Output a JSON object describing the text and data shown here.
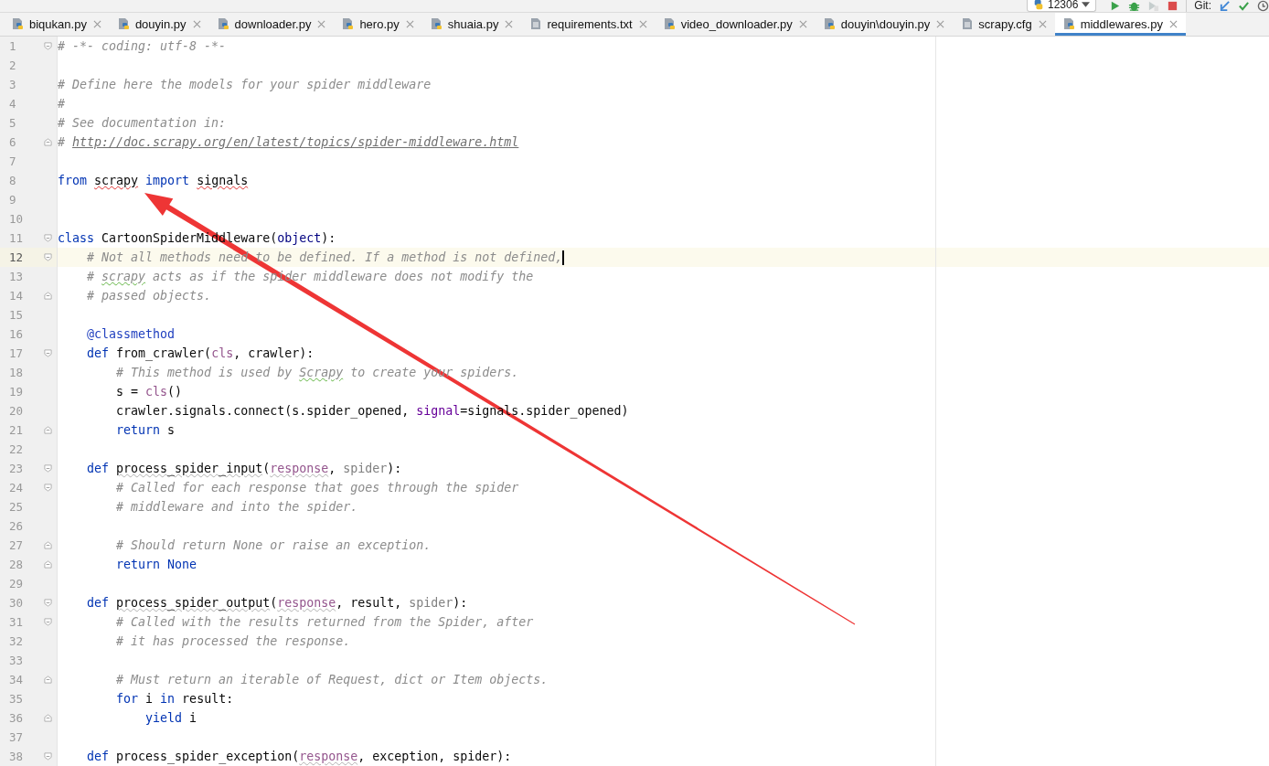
{
  "toolbar": {
    "run_config": "12306",
    "git_label": "Git:",
    "buttons": [
      {
        "kind": "run",
        "disabled": false
      },
      {
        "kind": "debug",
        "disabled": false
      },
      {
        "kind": "coverage",
        "disabled": true
      },
      {
        "kind": "stop",
        "disabled": false
      }
    ],
    "git_buttons": [
      {
        "kind": "update"
      },
      {
        "kind": "commit"
      },
      {
        "kind": "history"
      }
    ]
  },
  "tabs": [
    {
      "label": "biqukan.py",
      "kind": "python",
      "selected": false
    },
    {
      "label": "douyin.py",
      "kind": "python",
      "selected": false
    },
    {
      "label": "downloader.py",
      "kind": "python",
      "selected": false
    },
    {
      "label": "hero.py",
      "kind": "python",
      "selected": false
    },
    {
      "label": "shuaia.py",
      "kind": "python",
      "selected": false
    },
    {
      "label": "requirements.txt",
      "kind": "text",
      "selected": false
    },
    {
      "label": "video_downloader.py",
      "kind": "python",
      "selected": false
    },
    {
      "label": "douyin\\douyin.py",
      "kind": "python",
      "selected": false
    },
    {
      "label": "scrapy.cfg",
      "kind": "text",
      "selected": false
    },
    {
      "label": "middlewares.py",
      "kind": "python",
      "selected": true
    }
  ],
  "lines": [
    {
      "number": "1",
      "fold_open": true,
      "fold_close": false,
      "current": false,
      "tokens": [
        {
          "kind": "comment",
          "text": "# -*- coding: utf-8 -*-"
        }
      ]
    },
    {
      "number": "2",
      "fold_open": false,
      "fold_close": false,
      "current": false
    },
    {
      "number": "3",
      "fold_open": false,
      "fold_close": false,
      "current": false,
      "tokens": [
        {
          "kind": "comment",
          "text": "# Define here the models for your spider middleware"
        }
      ]
    },
    {
      "number": "4",
      "fold_open": false,
      "fold_close": false,
      "current": false,
      "tokens": [
        {
          "kind": "comment",
          "text": "#"
        }
      ]
    },
    {
      "number": "5",
      "fold_open": false,
      "fold_close": false,
      "current": false,
      "tokens": [
        {
          "kind": "comment",
          "text": "# See documentation in:"
        }
      ]
    },
    {
      "number": "6",
      "fold_open": false,
      "fold_close": true,
      "current": false,
      "tokens": [
        {
          "kind": "comment",
          "text": "# "
        },
        {
          "kind": "link",
          "text": "http://doc.scrapy.org/en/latest/topics/spider-middleware.html"
        }
      ]
    },
    {
      "number": "7",
      "fold_open": false,
      "fold_close": false,
      "current": false
    },
    {
      "number": "8",
      "fold_open": false,
      "fold_close": false,
      "current": false,
      "tokens": [
        {
          "kind": "keyword",
          "text": "from "
        },
        {
          "kind": "unresolved",
          "text": "scrapy"
        },
        {
          "kind": "keyword",
          "text": " import "
        },
        {
          "kind": "unresolved",
          "text": "signals"
        }
      ]
    },
    {
      "number": "9",
      "fold_open": false,
      "fold_close": false,
      "current": false
    },
    {
      "number": "10",
      "fold_open": false,
      "fold_close": false,
      "current": false
    },
    {
      "number": "11",
      "fold_open": true,
      "fold_close": false,
      "current": false,
      "tokens": [
        {
          "kind": "keyword",
          "text": "class"
        },
        {
          "kind": "plain",
          "text": " CartoonSpiderMiddleware("
        },
        {
          "kind": "builtin",
          "text": "object"
        },
        {
          "kind": "plain",
          "text": "):"
        }
      ]
    },
    {
      "number": "12",
      "fold_open": true,
      "fold_close": false,
      "current": true,
      "tokens": [
        {
          "kind": "comment",
          "text": "    # Not all methods need to be defined. If a method is not defined,"
        }
      ]
    },
    {
      "number": "13",
      "fold_open": false,
      "fold_close": false,
      "current": false,
      "tokens": [
        {
          "kind": "comment",
          "text": "    # "
        },
        {
          "kind": "misspelt",
          "text": "scrapy"
        },
        {
          "kind": "comment",
          "text": " acts as if the spider middleware does not modify the"
        }
      ]
    },
    {
      "number": "14",
      "fold_open": false,
      "fold_close": true,
      "current": false,
      "tokens": [
        {
          "kind": "comment",
          "text": "    # passed objects."
        }
      ]
    },
    {
      "number": "15",
      "fold_open": false,
      "fold_close": false,
      "current": false
    },
    {
      "number": "16",
      "fold_open": false,
      "fold_close": false,
      "current": false,
      "tokens": [
        {
          "kind": "decorator",
          "text": "    @classmethod"
        }
      ]
    },
    {
      "number": "17",
      "fold_open": true,
      "fold_close": false,
      "current": false,
      "tokens": [
        {
          "kind": "keyword",
          "text": "    def"
        },
        {
          "kind": "plain",
          "text": " from_crawler("
        },
        {
          "kind": "param",
          "text": "cls"
        },
        {
          "kind": "plain",
          "text": ", crawler):"
        }
      ]
    },
    {
      "number": "18",
      "fold_open": false,
      "fold_close": false,
      "current": false,
      "tokens": [
        {
          "kind": "comment",
          "text": "        # This method is used by "
        },
        {
          "kind": "misspelt",
          "text": "Scrapy"
        },
        {
          "kind": "comment",
          "text": " to create your spiders."
        }
      ]
    },
    {
      "number": "19",
      "fold_open": false,
      "fold_close": false,
      "current": false,
      "tokens": [
        {
          "kind": "plain",
          "text": "        s = "
        },
        {
          "kind": "param",
          "text": "cls"
        },
        {
          "kind": "plain",
          "text": "()"
        }
      ]
    },
    {
      "number": "20",
      "fold_open": false,
      "fold_close": false,
      "current": false,
      "tokens": [
        {
          "kind": "plain",
          "text": "        crawler.signals.connect(s.spider_opened, "
        },
        {
          "kind": "kwarg",
          "text": "signal"
        },
        {
          "kind": "plain",
          "text": "=signals.spider_opened)"
        }
      ]
    },
    {
      "number": "21",
      "fold_open": false,
      "fold_close": true,
      "current": false,
      "tokens": [
        {
          "kind": "keyword",
          "text": "        return"
        },
        {
          "kind": "plain",
          "text": " s"
        }
      ]
    },
    {
      "number": "22",
      "fold_open": false,
      "fold_close": false,
      "current": false
    },
    {
      "number": "23",
      "fold_open": true,
      "fold_close": false,
      "current": false,
      "tokens": [
        {
          "kind": "keyword",
          "text": "    def "
        },
        {
          "kind": "warned",
          "text": "process_spider_input"
        },
        {
          "kind": "plain",
          "text": "("
        },
        {
          "kind": "warnedparam",
          "text": "response"
        },
        {
          "kind": "plain",
          "text": ", "
        },
        {
          "kind": "unused",
          "text": "spider"
        },
        {
          "kind": "plain",
          "text": "):"
        }
      ]
    },
    {
      "number": "24",
      "fold_open": true,
      "fold_close": false,
      "current": false,
      "tokens": [
        {
          "kind": "comment",
          "text": "        # Called for each response that goes through the spider"
        }
      ]
    },
    {
      "number": "25",
      "fold_open": false,
      "fold_close": false,
      "current": false,
      "tokens": [
        {
          "kind": "comment",
          "text": "        # middleware and into the spider."
        }
      ]
    },
    {
      "number": "26",
      "fold_open": false,
      "fold_close": false,
      "current": false
    },
    {
      "number": "27",
      "fold_open": false,
      "fold_close": true,
      "current": false,
      "tokens": [
        {
          "kind": "comment",
          "text": "        # Should return None or raise an exception."
        }
      ]
    },
    {
      "number": "28",
      "fold_open": false,
      "fold_close": true,
      "current": false,
      "tokens": [
        {
          "kind": "keyword",
          "text": "        return None"
        }
      ]
    },
    {
      "number": "29",
      "fold_open": false,
      "fold_close": false,
      "current": false
    },
    {
      "number": "30",
      "fold_open": true,
      "fold_close": false,
      "current": false,
      "tokens": [
        {
          "kind": "keyword",
          "text": "    def "
        },
        {
          "kind": "warned",
          "text": "process_spider_output"
        },
        {
          "kind": "plain",
          "text": "("
        },
        {
          "kind": "warnedparam",
          "text": "response"
        },
        {
          "kind": "plain",
          "text": ", result, "
        },
        {
          "kind": "unused",
          "text": "spider"
        },
        {
          "kind": "plain",
          "text": "):"
        }
      ]
    },
    {
      "number": "31",
      "fold_open": true,
      "fold_close": false,
      "current": false,
      "tokens": [
        {
          "kind": "comment",
          "text": "        # Called with the results returned from the Spider, after"
        }
      ]
    },
    {
      "number": "32",
      "fold_open": false,
      "fold_close": false,
      "current": false,
      "tokens": [
        {
          "kind": "comment",
          "text": "        # it has processed the response."
        }
      ]
    },
    {
      "number": "33",
      "fold_open": false,
      "fold_close": false,
      "current": false
    },
    {
      "number": "34",
      "fold_open": false,
      "fold_close": true,
      "current": false,
      "tokens": [
        {
          "kind": "comment",
          "text": "        # Must return an iterable of Request, dict or Item objects."
        }
      ]
    },
    {
      "number": "35",
      "fold_open": false,
      "fold_close": false,
      "current": false,
      "tokens": [
        {
          "kind": "keyword",
          "text": "        for"
        },
        {
          "kind": "plain",
          "text": " i "
        },
        {
          "kind": "keyword",
          "text": "in"
        },
        {
          "kind": "plain",
          "text": " result:"
        }
      ]
    },
    {
      "number": "36",
      "fold_open": false,
      "fold_close": true,
      "current": false,
      "tokens": [
        {
          "kind": "keyword",
          "text": "            yield"
        },
        {
          "kind": "plain",
          "text": " i"
        }
      ]
    },
    {
      "number": "37",
      "fold_open": false,
      "fold_close": false,
      "current": false
    },
    {
      "number": "38",
      "fold_open": true,
      "fold_close": false,
      "current": false,
      "tokens": [
        {
          "kind": "keyword",
          "text": "    def"
        },
        {
          "kind": "plain",
          "text": " process_spider_exception("
        },
        {
          "kind": "warnedparam",
          "text": "response"
        },
        {
          "kind": "plain",
          "text": ", exception, spider):"
        }
      ]
    }
  ]
}
